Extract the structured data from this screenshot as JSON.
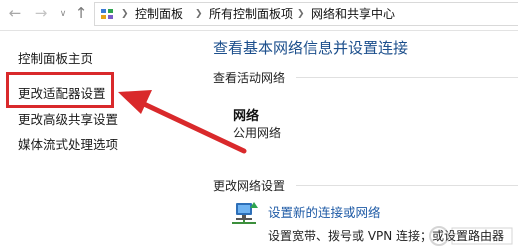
{
  "navigation": {
    "back_icon": "back-arrow-icon",
    "forward_icon": "forward-arrow-icon",
    "recent_icon": "chevron-down-icon",
    "up_icon": "up-arrow-icon"
  },
  "breadcrumb": {
    "icon": "control-panel-icon",
    "items": [
      "控制面板",
      "所有控制面板项",
      "网络和共享中心"
    ]
  },
  "sidebar": {
    "items": [
      {
        "label": "控制面板主页"
      },
      {
        "label": "更改适配器设置"
      },
      {
        "label": "更改高级共享设置"
      },
      {
        "label": "媒体流式处理选项"
      }
    ],
    "highlight_color": "#d9292b"
  },
  "main": {
    "title": "查看基本网络信息并设置连接",
    "active_networks_label": "查看活动网络",
    "network": {
      "name": "网络",
      "type": "公用网络"
    },
    "change_settings_label": "更改网络设置",
    "task": {
      "icon": "network-setup-icon",
      "link": "设置新的连接或网络",
      "description": "设置宽带、拨号或 VPN 连接；或设置路由器"
    }
  },
  "colors": {
    "title_blue": "#1c4f8c",
    "link_blue": "#1f5ba6",
    "annotation_red": "#d9292b"
  }
}
